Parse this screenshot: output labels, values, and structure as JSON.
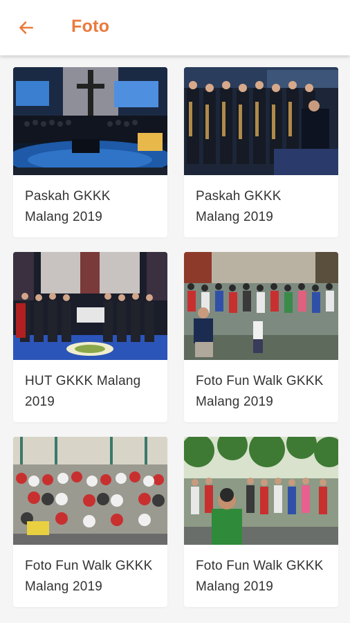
{
  "header": {
    "title": "Foto",
    "back_icon": "arrow-left-icon",
    "accent_color": "#ea7a3c"
  },
  "photos": [
    {
      "caption": "Paskah GKKK Malang 2019"
    },
    {
      "caption": "Paskah GKKK Malang 2019"
    },
    {
      "caption": "HUT GKKK Malang 2019"
    },
    {
      "caption": "Foto Fun Walk GKKK Malang 2019"
    },
    {
      "caption": "Foto Fun Walk GKKK Malang 2019"
    },
    {
      "caption": "Foto Fun Walk GKKK Malang 2019"
    }
  ]
}
